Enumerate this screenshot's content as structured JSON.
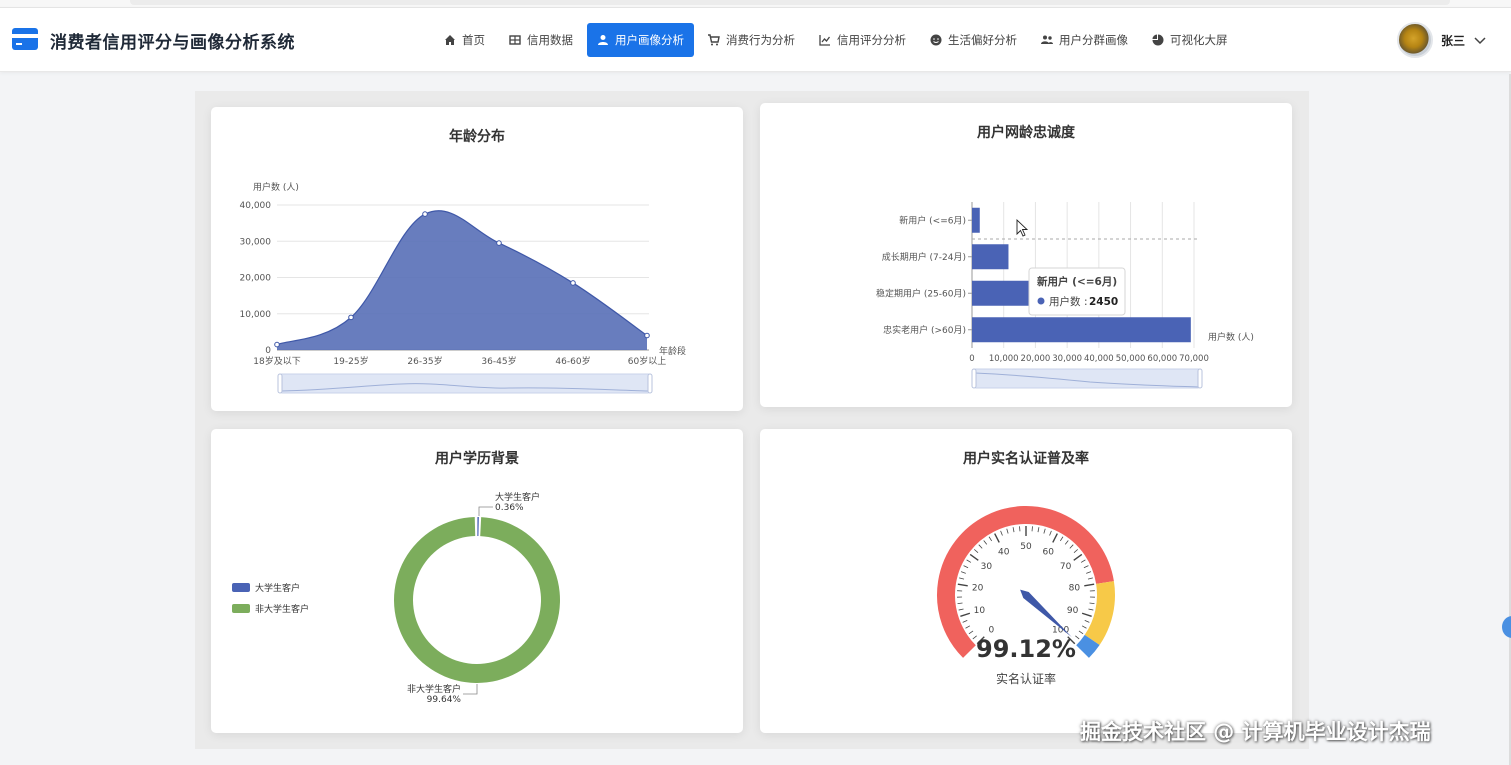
{
  "app": {
    "title": "消费者信用评分与画像分析系统"
  },
  "nav": [
    {
      "label": "首页",
      "icon": "home-icon"
    },
    {
      "label": "信用数据",
      "icon": "table-icon"
    },
    {
      "label": "用户画像分析",
      "icon": "user-icon",
      "active": true
    },
    {
      "label": "消费行为分析",
      "icon": "cart-icon"
    },
    {
      "label": "信用评分分析",
      "icon": "line-chart-icon"
    },
    {
      "label": "生活偏好分析",
      "icon": "smile-icon"
    },
    {
      "label": "用户分群画像",
      "icon": "users-icon"
    },
    {
      "label": "可视化大屏",
      "icon": "pie-icon"
    }
  ],
  "user": {
    "name": "张三"
  },
  "colors": {
    "accent": "#1a73e8",
    "series_blue": "#4a63b5",
    "green": "#7cad5c",
    "gauge_red": "#f0625d",
    "gauge_yellow": "#f7c948",
    "gauge_blue": "#4a90e2"
  },
  "cards": {
    "age": {
      "title": "年龄分布"
    },
    "loyalty": {
      "title": "用户网龄忠诚度"
    },
    "education": {
      "title": "用户学历背景"
    },
    "realname": {
      "title": "用户实名认证普及率"
    }
  },
  "watermark": "掘金技术社区 @ 计算机毕业设计杰瑞",
  "chart_data": [
    {
      "type": "area",
      "title": "年龄分布",
      "ylabel": "用户数 (人)",
      "xlabel": "年龄段",
      "categories": [
        "18岁及以下",
        "19-25岁",
        "26-35岁",
        "36-45岁",
        "46-60岁",
        "60岁以上"
      ],
      "values": [
        1500,
        9000,
        37500,
        29500,
        18500,
        4000
      ],
      "ylim": [
        0,
        40000
      ],
      "yticks": [
        "0",
        "10,000",
        "20,000",
        "30,000",
        "40,000"
      ],
      "grid": true,
      "smooth": true
    },
    {
      "type": "bar",
      "orientation": "horizontal",
      "title": "用户网龄忠诚度",
      "xlabel": "用户数 (人)",
      "categories": [
        "新用户 (<=6月)",
        "成长期用户 (7-24月)",
        "稳定期用户 (25-60月)",
        "忠实老用户 (>60月)"
      ],
      "values": [
        2450,
        11500,
        18000,
        69000
      ],
      "xlim": [
        0,
        70000
      ],
      "xticks": [
        "0",
        "10,000",
        "20,000",
        "30,000",
        "40,000",
        "50,000",
        "60,000",
        "70,000"
      ],
      "grid": true,
      "tooltip": {
        "title": "新用户 (<=6月)",
        "series": "用户数",
        "value": "2450"
      }
    },
    {
      "type": "pie",
      "style": "donut",
      "title": "用户学历背景",
      "slices": [
        {
          "name": "大学生客户",
          "percent": 0.36,
          "label": "0.36%",
          "color": "#4a63b5"
        },
        {
          "name": "非大学生客户",
          "percent": 99.64,
          "label": "99.64%",
          "color": "#7cad5c"
        }
      ],
      "legend": "left"
    },
    {
      "type": "gauge",
      "title": "用户实名认证普及率",
      "value": 99.12,
      "display": "99.12%",
      "label": "实名认证率",
      "min": 0,
      "max": 100,
      "ticks": [
        "0",
        "10",
        "20",
        "30",
        "40",
        "50",
        "60",
        "70",
        "80",
        "90",
        "100"
      ]
    }
  ]
}
